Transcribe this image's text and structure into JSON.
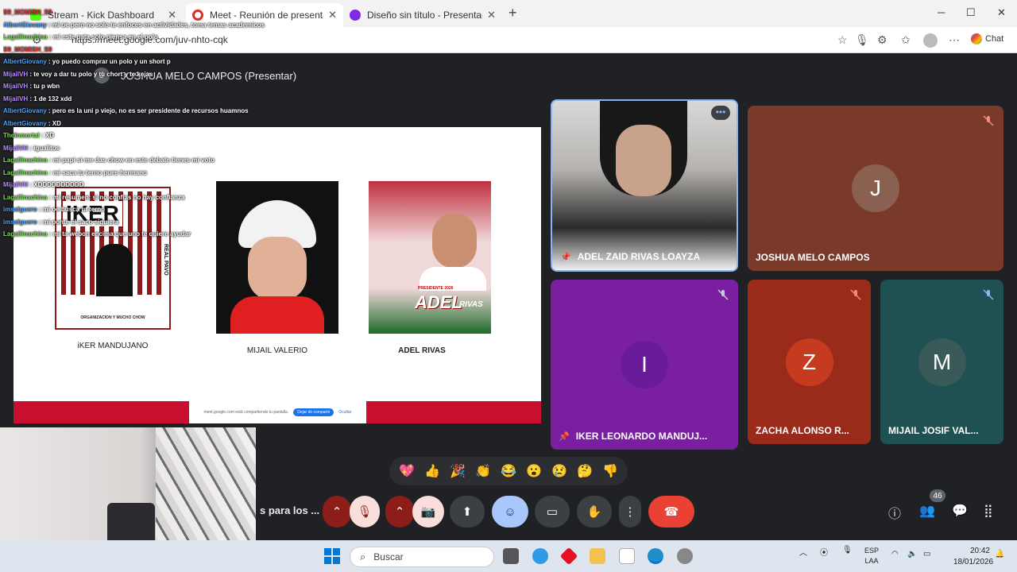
{
  "browser": {
    "tabs": [
      {
        "title": "Stream - Kick Dashboard",
        "active": false
      },
      {
        "title": "Meet - Reunión de presentación",
        "active": true
      },
      {
        "title": "Diseño sin título - Presentación",
        "active": false
      }
    ],
    "new_tab": "+",
    "url": "https://meet.google.com/juv-nhto-cqk",
    "chat_label": "Chat"
  },
  "meet": {
    "presenter_initial": "J",
    "presenter_label": "JOSHUA MELO CAMPOS (Presentar)",
    "meeting_title": "s para los ...",
    "people_count": "46",
    "reactions": [
      "💖",
      "👍",
      "🎉",
      "👏",
      "😂",
      "😮",
      "😢",
      "🤔",
      "👎"
    ],
    "participants": [
      {
        "name": "ADEL ZAID RIVAS LOAYZA",
        "letter": "",
        "pinned": true
      },
      {
        "name": "JOSHUA MELO CAMPOS",
        "letter": "J",
        "pinned": false
      },
      {
        "name": "IKER LEONARDO MANDUJ...",
        "letter": "I",
        "pinned": true
      },
      {
        "name": "ZACHA ALONSO R...",
        "letter": "Z",
        "pinned": false
      },
      {
        "name": "MIJAIL JOSIF VAL...",
        "letter": "M",
        "pinned": false
      }
    ]
  },
  "slide": {
    "candidates": [
      {
        "name": "iKER MANDUJANO"
      },
      {
        "name": "MIJAIL VALERIO"
      },
      {
        "name": "ADEL RIVAS"
      }
    ],
    "poster_big_text": "IKER",
    "poster_side_text": "REAL PAVO",
    "poster_footer": "ORGANIZACION Y MUCHO CHOW",
    "adel_poster_title": "ADEL",
    "adel_poster_sub": "RIVAS",
    "adel_poster_tag": "PRESIDENTE 2026",
    "share_text": "meet.google.com está compartiendo tu pantalla.",
    "share_stop": "Dejar de compartir",
    "share_hide": "Ocultar"
  },
  "chat": [
    {
      "user": "S9_MOMISH_S9",
      "msg": "",
      "color": "#e04040"
    },
    {
      "user": "AlbertGiovany",
      "msg": "mi oe pero no solo te enfoces en actividades, toma temas academicos",
      "color": "#4fa3ff"
    },
    {
      "user": "Lagallinachina",
      "msg": "mi este pata solo piensa en el polo",
      "color": "#7fdc5a"
    },
    {
      "user": "S9_MOMISH_S9",
      "msg": "",
      "color": "#e04040"
    },
    {
      "user": "AlbertGiovany",
      "msg": "yo puedo comprar un polo y un short p",
      "color": "#4fa3ff"
    },
    {
      "user": "MijailVH",
      "msg": "te voy a dar tu polo y tu chort y te kejas",
      "color": "#b98cff"
    },
    {
      "user": "MijailVH",
      "msg": "tu p wbn",
      "color": "#b98cff"
    },
    {
      "user": "MijailVH",
      "msg": "1 de 132 xdd",
      "color": "#b98cff"
    },
    {
      "user": "AlbertGiovany",
      "msg": "pero es la uni p viejo, no es ser presidente de recursos huamnos",
      "color": "#4fa3ff"
    },
    {
      "user": "AlbertGiovany",
      "msg": "XD",
      "color": "#4fa3ff"
    },
    {
      "user": "TheInmortal",
      "msg": "XD",
      "color": "#7fdc5a"
    },
    {
      "user": "MijailVH",
      "msg": "igualitos",
      "color": "#b98cff"
    },
    {
      "user": "Lagallinachina",
      "msg": "mi papi si me das chow en este debate tienes mi voto",
      "color": "#7fdc5a"
    },
    {
      "user": "Lagallinachina",
      "msg": "mi saca tu terno pues hermano",
      "color": "#7fdc5a"
    },
    {
      "user": "MijailVH",
      "msg": "XDDDDDDDDDD",
      "color": "#b98cff"
    },
    {
      "user": "Lagallinachina",
      "msg": "mi resumen: si no confias no hay confianza",
      "color": "#7fdc5a"
    },
    {
      "user": "imsalguero",
      "msg": "mi oe busca tu terno",
      "color": "#4fa3ff"
    },
    {
      "user": "imsalguero",
      "msg": "mi ponte el saco siquiera",
      "color": "#4fa3ff"
    },
    {
      "user": "Lagallinachina",
      "msg": "mi ta webon encima que uno te quiere ayudar",
      "color": "#7fdc5a"
    }
  ],
  "taskbar": {
    "search_placeholder": "Buscar",
    "lang_top": "ESP",
    "lang_bottom": "LAA",
    "time": "20:42",
    "date": "18/01/2026"
  },
  "colors": {
    "meet_bg": "#202124",
    "end_call": "#e94235",
    "tile_joshua": "#7a3a2a",
    "tile_iker": "#7b1fa2",
    "tile_zacha": "#9a2a1a",
    "tile_mijail": "#1f5152"
  }
}
